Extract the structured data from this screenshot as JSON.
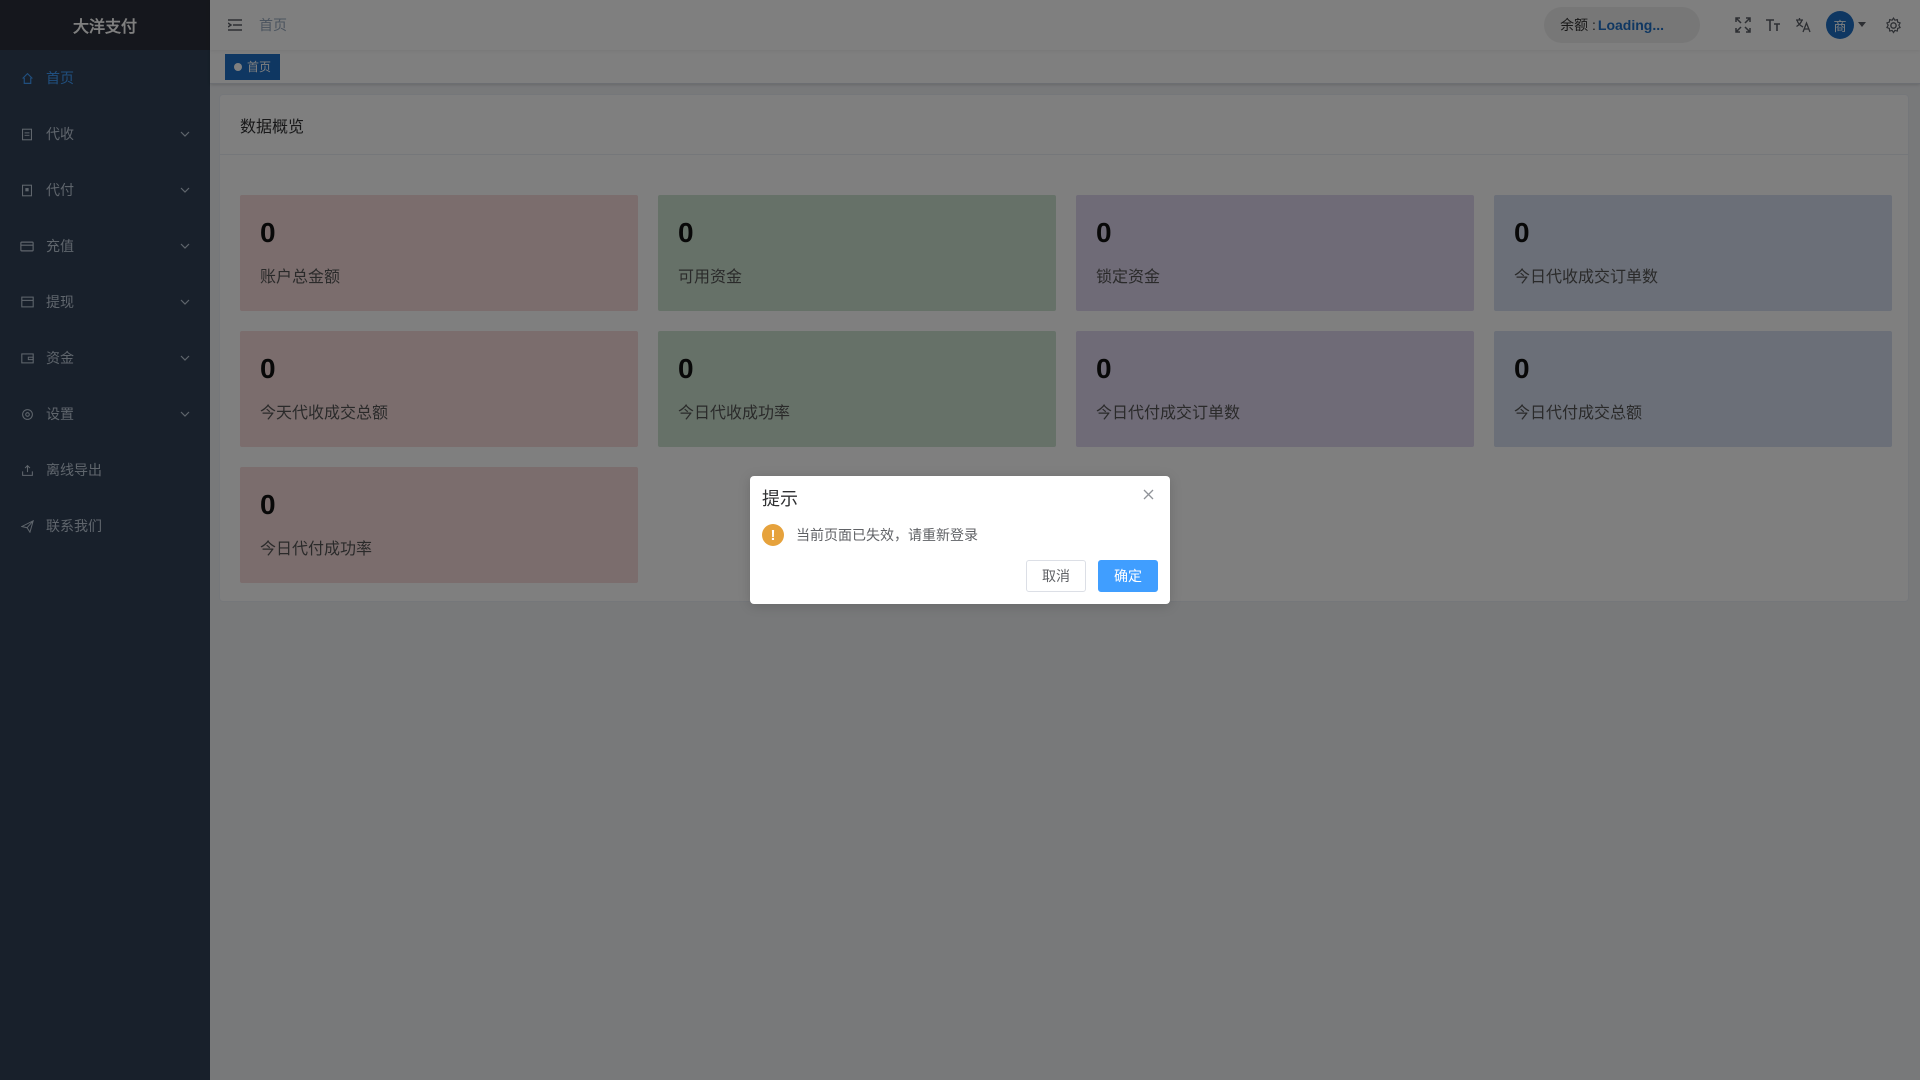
{
  "app": {
    "logo": "大洋支付"
  },
  "sidebar": {
    "items": [
      {
        "label": "首页",
        "icon": "home-icon",
        "active": true
      },
      {
        "label": "代收",
        "icon": "document-icon"
      },
      {
        "label": "代付",
        "icon": "payment-icon"
      },
      {
        "label": "充值",
        "icon": "card-icon"
      },
      {
        "label": "提现",
        "icon": "withdraw-icon"
      },
      {
        "label": "资金",
        "icon": "wallet-icon"
      },
      {
        "label": "设置",
        "icon": "settings-icon"
      },
      {
        "label": "离线导出",
        "icon": "export-icon"
      },
      {
        "label": "联系我们",
        "icon": "send-icon"
      }
    ]
  },
  "navbar": {
    "breadcrumb": "首页",
    "balance_label": "余额 :",
    "balance_value": "Loading...",
    "avatar_text": "商"
  },
  "tags": [
    {
      "label": "首页"
    }
  ],
  "panel": {
    "title": "数据概览",
    "cards": [
      {
        "value": "0",
        "label": "账户总金额",
        "color": "#f6dada"
      },
      {
        "value": "0",
        "label": "可用资金",
        "color": "#cde3d0"
      },
      {
        "value": "0",
        "label": "锁定资金",
        "color": "#dfd6ef"
      },
      {
        "value": "0",
        "label": "今日代收成交订单数",
        "color": "#d7dff1"
      },
      {
        "value": "0",
        "label": "今天代收成交总额",
        "color": "#f6dada"
      },
      {
        "value": "0",
        "label": "今日代收成功率",
        "color": "#cde3d0"
      },
      {
        "value": "0",
        "label": "今日代付成交订单数",
        "color": "#dfd6ef"
      },
      {
        "value": "0",
        "label": "今日代付成交总额",
        "color": "#d7dff1"
      },
      {
        "value": "0",
        "label": "今日代付成功率",
        "color": "#f6dada"
      }
    ]
  },
  "dialog": {
    "title": "提示",
    "message": "当前页面已失效，请重新登录",
    "warn_glyph": "!",
    "cancel_label": "取消",
    "confirm_label": "确定"
  },
  "colors": {
    "sidebar_bg": "#304156",
    "accent": "#409eff",
    "warning": "#e6a23c"
  }
}
